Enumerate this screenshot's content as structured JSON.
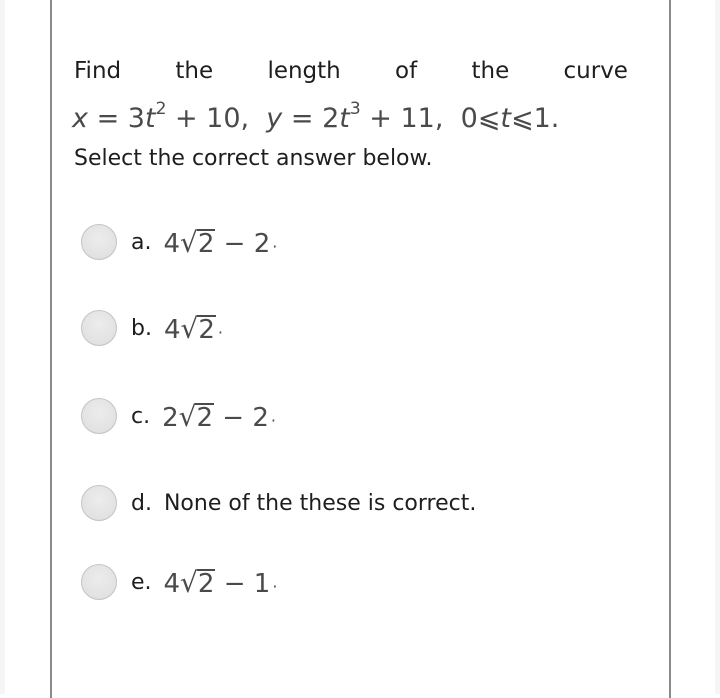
{
  "question": {
    "words": [
      "Find",
      "the",
      "length",
      "of",
      "the",
      "curve"
    ],
    "equation": {
      "x_lhs": "x",
      "x_rhs_coef": "3",
      "x_var": "t",
      "x_exp": "2",
      "x_rest": " + 10,",
      "y_lhs": "y",
      "y_rhs_coef": "2",
      "y_var": "t",
      "y_exp": "3",
      "y_rest": " + 11,",
      "range_start": "0",
      "range_var": "t",
      "range_end": "1.",
      "leq": "⩽",
      "eq": " = "
    },
    "instruction": "Select the correct answer below."
  },
  "options": [
    {
      "letter": "a.",
      "coef": "4",
      "radicand": "2",
      "tail": " − 2",
      "dot": "·",
      "text": null
    },
    {
      "letter": "b.",
      "coef": "4",
      "radicand": "2",
      "tail": "",
      "dot": "·",
      "text": null
    },
    {
      "letter": "c.",
      "coef": "2",
      "radicand": "2",
      "tail": " − 2",
      "dot": "·",
      "text": null
    },
    {
      "letter": "d.",
      "text": "None of the these is correct."
    },
    {
      "letter": "e.",
      "coef": "4",
      "radicand": "2",
      "tail": " − 1",
      "dot": "·",
      "text": null
    }
  ],
  "radical_symbol": "√"
}
